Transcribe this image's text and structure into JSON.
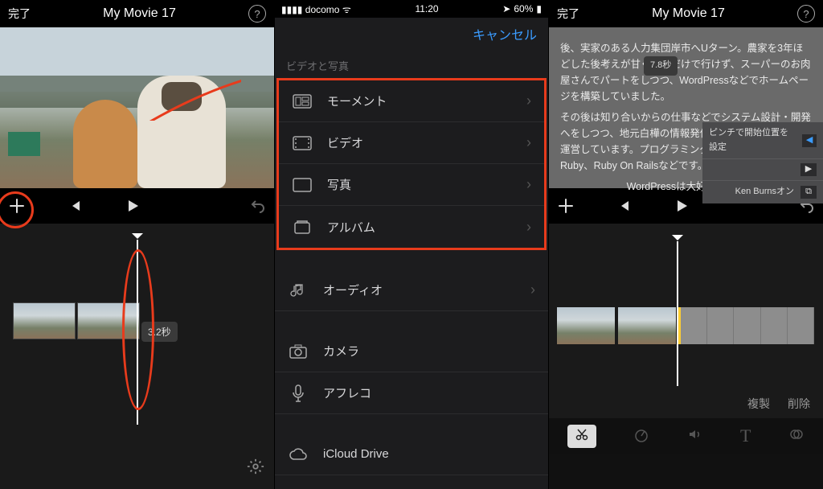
{
  "colors": {
    "accent": "#3b9cff",
    "annotation": "#e83b1c",
    "highlight": "#ffcf33"
  },
  "screen1": {
    "done_label": "完了",
    "title": "My Movie 17",
    "help_label": "?",
    "clip_duration": "3.2秒"
  },
  "screen2": {
    "status": {
      "carrier": "docomo",
      "time": "11:20",
      "battery": "60%",
      "signal_icon": "▮▮▮▮",
      "wifi_icon": "⋮",
      "nav_icon": "➤"
    },
    "cancel_label": "キャンセル",
    "section_header": "ビデオと写真",
    "media_items": [
      {
        "icon": "moments",
        "label": "モーメント"
      },
      {
        "icon": "video",
        "label": "ビデオ"
      },
      {
        "icon": "photo",
        "label": "写真"
      },
      {
        "icon": "album",
        "label": "アルバム"
      }
    ],
    "audio_item": {
      "icon": "audio",
      "label": "オーディオ"
    },
    "camera_item": {
      "icon": "camera",
      "label": "カメラ"
    },
    "voiceover_item": {
      "icon": "mic",
      "label": "アフレコ"
    },
    "icloud_item": {
      "icon": "cloud",
      "label": "iCloud Drive"
    }
  },
  "screen3": {
    "done_label": "完了",
    "title": "My Movie 17",
    "help_label": "?",
    "clip_duration": "7.8秒",
    "overlay_text": {
      "p1": "後、実家のある人力集団岸市へUターン。農家を3年ほどした後考えが甘く収入だけで行けず、スーパーのお肉屋さんでパートをしつつ、WordPressなどでホームページを構築していました。",
      "p2": "その後は知り合いからの仕事などでシステム設計・開発へをしつつ、地元白樺の情報発信サイト(※3)を6年ほど運営しています。プログラミングスキルは、PHP、Ruby、Ruby On Railsなどです。",
      "p3": "WordPressは大好きです。"
    },
    "side_controls": {
      "pinch_label": "ピンチで開始位置を設定",
      "kenburns_label": "Ken Burnsオン"
    },
    "edit_actions": {
      "duplicate": "複製",
      "delete": "削除"
    },
    "tools": {
      "cut": "✂",
      "speed": "⏱",
      "volume": "🔊",
      "text": "T",
      "filter": "◉"
    }
  }
}
